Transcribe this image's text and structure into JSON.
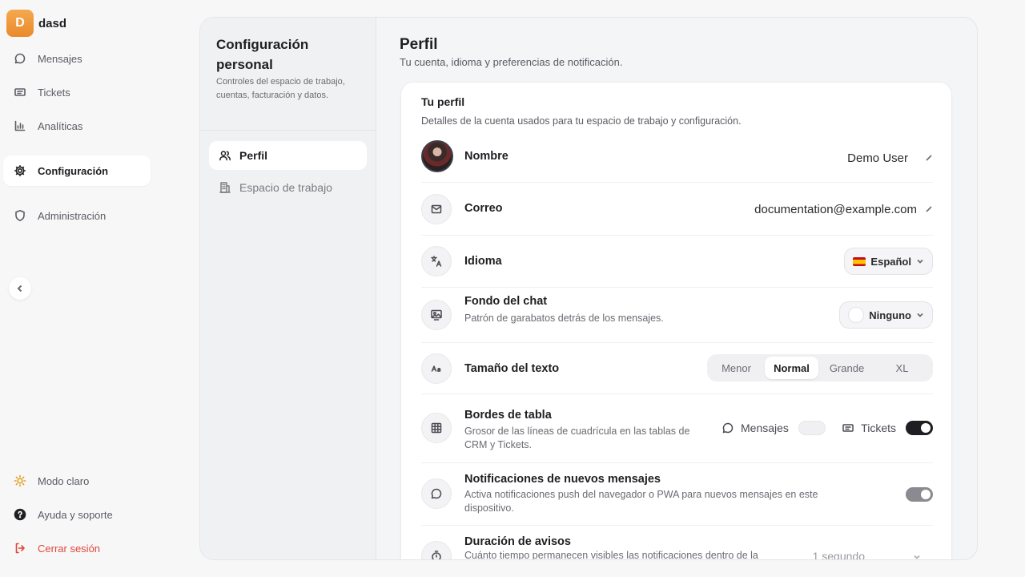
{
  "workspace": {
    "initial": "D",
    "name": "dasd"
  },
  "nav": {
    "messages": "Mensajes",
    "tickets": "Tickets",
    "analytics": "Analíticas",
    "settings": "Configuración",
    "admin": "Administración",
    "light_mode": "Modo claro",
    "help": "Ayuda y soporte",
    "logout": "Cerrar sesión"
  },
  "settings_nav": {
    "title": "Configuración personal",
    "description": "Controles del espacio de trabajo, cuentas, facturación y datos.",
    "items": [
      {
        "label": "Perfil",
        "icon": "users-icon",
        "active": true
      },
      {
        "label": "Espacio de trabajo",
        "icon": "building-icon",
        "active": false
      }
    ]
  },
  "page": {
    "title": "Perfil",
    "subtitle": "Tu cuenta, idioma y preferencias de notificación."
  },
  "card": {
    "title": "Tu perfil",
    "subtitle": "Detalles de la cuenta usados para tu espacio de trabajo y configuración.",
    "name": {
      "label": "Nombre",
      "value": "Demo User"
    },
    "email": {
      "label": "Correo",
      "value": "documentation@example.com"
    },
    "language": {
      "label": "Idioma",
      "value": "Español"
    },
    "chat_background": {
      "label": "Fondo del chat",
      "desc": "Patrón de garabatos detrás de los mensajes.",
      "value": "Ninguno"
    },
    "text_size": {
      "label": "Tamaño del texto",
      "options": [
        "Menor",
        "Normal",
        "Grande",
        "XL"
      ],
      "selected": "Normal"
    },
    "table_borders": {
      "label": "Bordes de tabla",
      "desc": "Grosor de las líneas de cuadrícula en las tablas de CRM y Tickets.",
      "messages_label": "Mensajes",
      "messages_on": false,
      "tickets_label": "Tickets",
      "tickets_on": true
    },
    "notifications": {
      "label": "Notificaciones de nuevos mensajes",
      "desc": "Activa notificaciones push del navegador o PWA para nuevos mensajes en este dispositivo.",
      "on": true
    },
    "toast_duration": {
      "label": "Duración de avisos",
      "desc": "Cuánto tiempo permanecen visibles las notificaciones dentro de la",
      "value": "1 segundo"
    }
  }
}
